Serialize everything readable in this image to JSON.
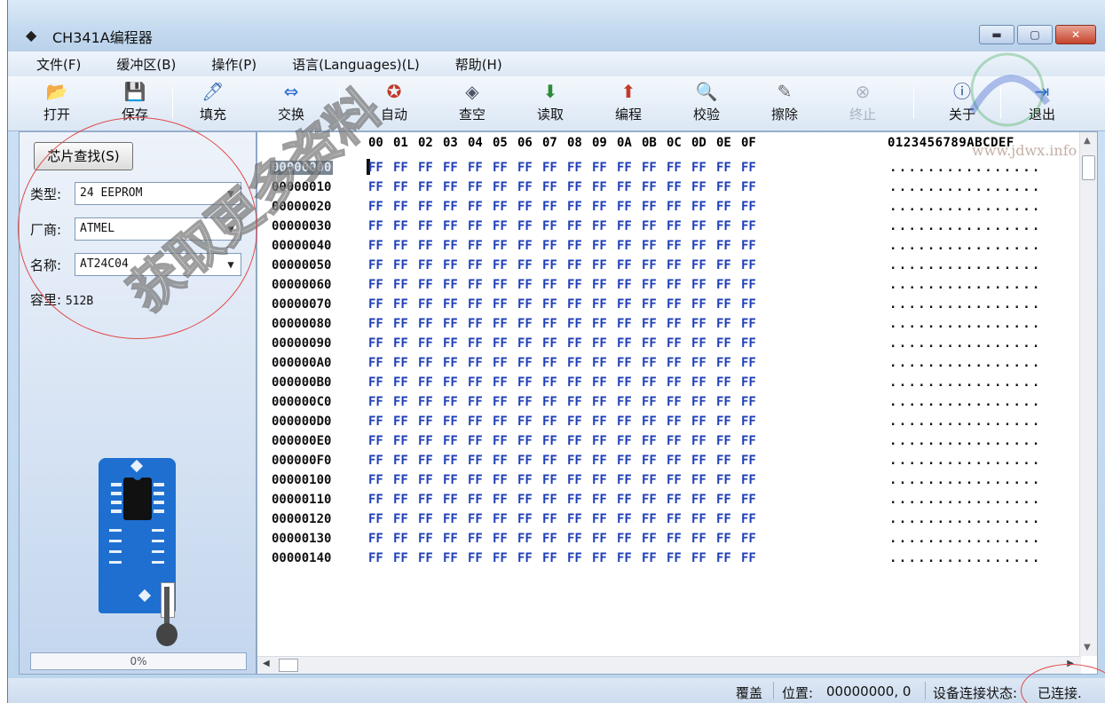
{
  "window": {
    "title": "CH341A编程器",
    "title_icon": "chip-app-icon",
    "controls": {
      "minimize": "minimize-icon",
      "maximize": "maximize-icon",
      "close": "close-icon"
    }
  },
  "menu": [
    {
      "label": "文件(F)"
    },
    {
      "label": "缓冲区(B)"
    },
    {
      "label": "操作(P)"
    },
    {
      "label": "语言(Languages)(L)"
    },
    {
      "label": "帮助(H)"
    }
  ],
  "toolbar": [
    {
      "label": "打开",
      "icon": "open-folder-icon",
      "glyph": "📂",
      "color": "#d89b18"
    },
    {
      "label": "保存",
      "icon": "save-disk-icon",
      "glyph": "💾",
      "color": "#224a88"
    },
    {
      "label": "填充",
      "icon": "fill-icon",
      "glyph": "🖊",
      "color": "#3b6fb0"
    },
    {
      "label": "交换",
      "icon": "swap-icon",
      "glyph": "⇔",
      "color": "#2a6ad0"
    },
    {
      "label": "自动",
      "icon": "auto-icon",
      "glyph": "✪",
      "color": "#c23b2b"
    },
    {
      "label": "查空",
      "icon": "blank-check-icon",
      "glyph": "◈",
      "color": "#4b5563"
    },
    {
      "label": "读取",
      "icon": "read-icon",
      "glyph": "⬇",
      "color": "#2f8a3a"
    },
    {
      "label": "编程",
      "icon": "program-icon",
      "glyph": "⬆",
      "color": "#c43a2a"
    },
    {
      "label": "校验",
      "icon": "verify-icon",
      "glyph": "🔍",
      "color": "#4a6a8a"
    },
    {
      "label": "擦除",
      "icon": "erase-icon",
      "glyph": "✎",
      "color": "#6a6a6a"
    },
    {
      "label": "终止",
      "icon": "stop-icon",
      "glyph": "⊗",
      "color": "#a9b4c0",
      "disabled": true
    },
    {
      "label": "关于",
      "icon": "info-icon",
      "glyph": "ⓘ",
      "color": "#2a4a8a"
    },
    {
      "label": "退出",
      "icon": "exit-icon",
      "glyph": "⇥",
      "color": "#2a6ad0"
    }
  ],
  "left_panel": {
    "chip_search_button": "芯片查找(S)",
    "type_label": "类型:",
    "type_value": "24 EEPROM",
    "vendor_label": "厂商:",
    "vendor_value": "ATMEL",
    "name_label": "名称:",
    "name_value": "AT24C04",
    "capacity_label": "容里:",
    "capacity_value": "512B",
    "progress_text": "0%",
    "progress_value": 0
  },
  "hex_view": {
    "column_headers": [
      "00",
      "01",
      "02",
      "03",
      "04",
      "05",
      "06",
      "07",
      "08",
      "09",
      "0A",
      "0B",
      "0C",
      "0D",
      "0E",
      "0F"
    ],
    "ascii_header": "0123456789ABCDEF",
    "rows": [
      {
        "addr": "00000000",
        "selected": true
      },
      {
        "addr": "00000010"
      },
      {
        "addr": "00000020"
      },
      {
        "addr": "00000030"
      },
      {
        "addr": "00000040"
      },
      {
        "addr": "00000050"
      },
      {
        "addr": "00000060"
      },
      {
        "addr": "00000070"
      },
      {
        "addr": "00000080"
      },
      {
        "addr": "00000090"
      },
      {
        "addr": "000000A0"
      },
      {
        "addr": "000000B0"
      },
      {
        "addr": "000000C0"
      },
      {
        "addr": "000000D0"
      },
      {
        "addr": "000000E0"
      },
      {
        "addr": "000000F0"
      },
      {
        "addr": "00000100"
      },
      {
        "addr": "00000110"
      },
      {
        "addr": "00000120"
      },
      {
        "addr": "00000130"
      },
      {
        "addr": "00000140"
      }
    ],
    "byte_value": "FF",
    "ascii_value": "................",
    "byte_color": "#1f3fb6"
  },
  "status": {
    "mode": "覆盖",
    "position_label": "位置:",
    "position_value": "00000000, 0",
    "connection_label": "设备连接状态:",
    "connection_value": "已连接."
  },
  "overlay": {
    "watermark": "获取更多资料",
    "site_watermark": "www.jdwx.info"
  }
}
